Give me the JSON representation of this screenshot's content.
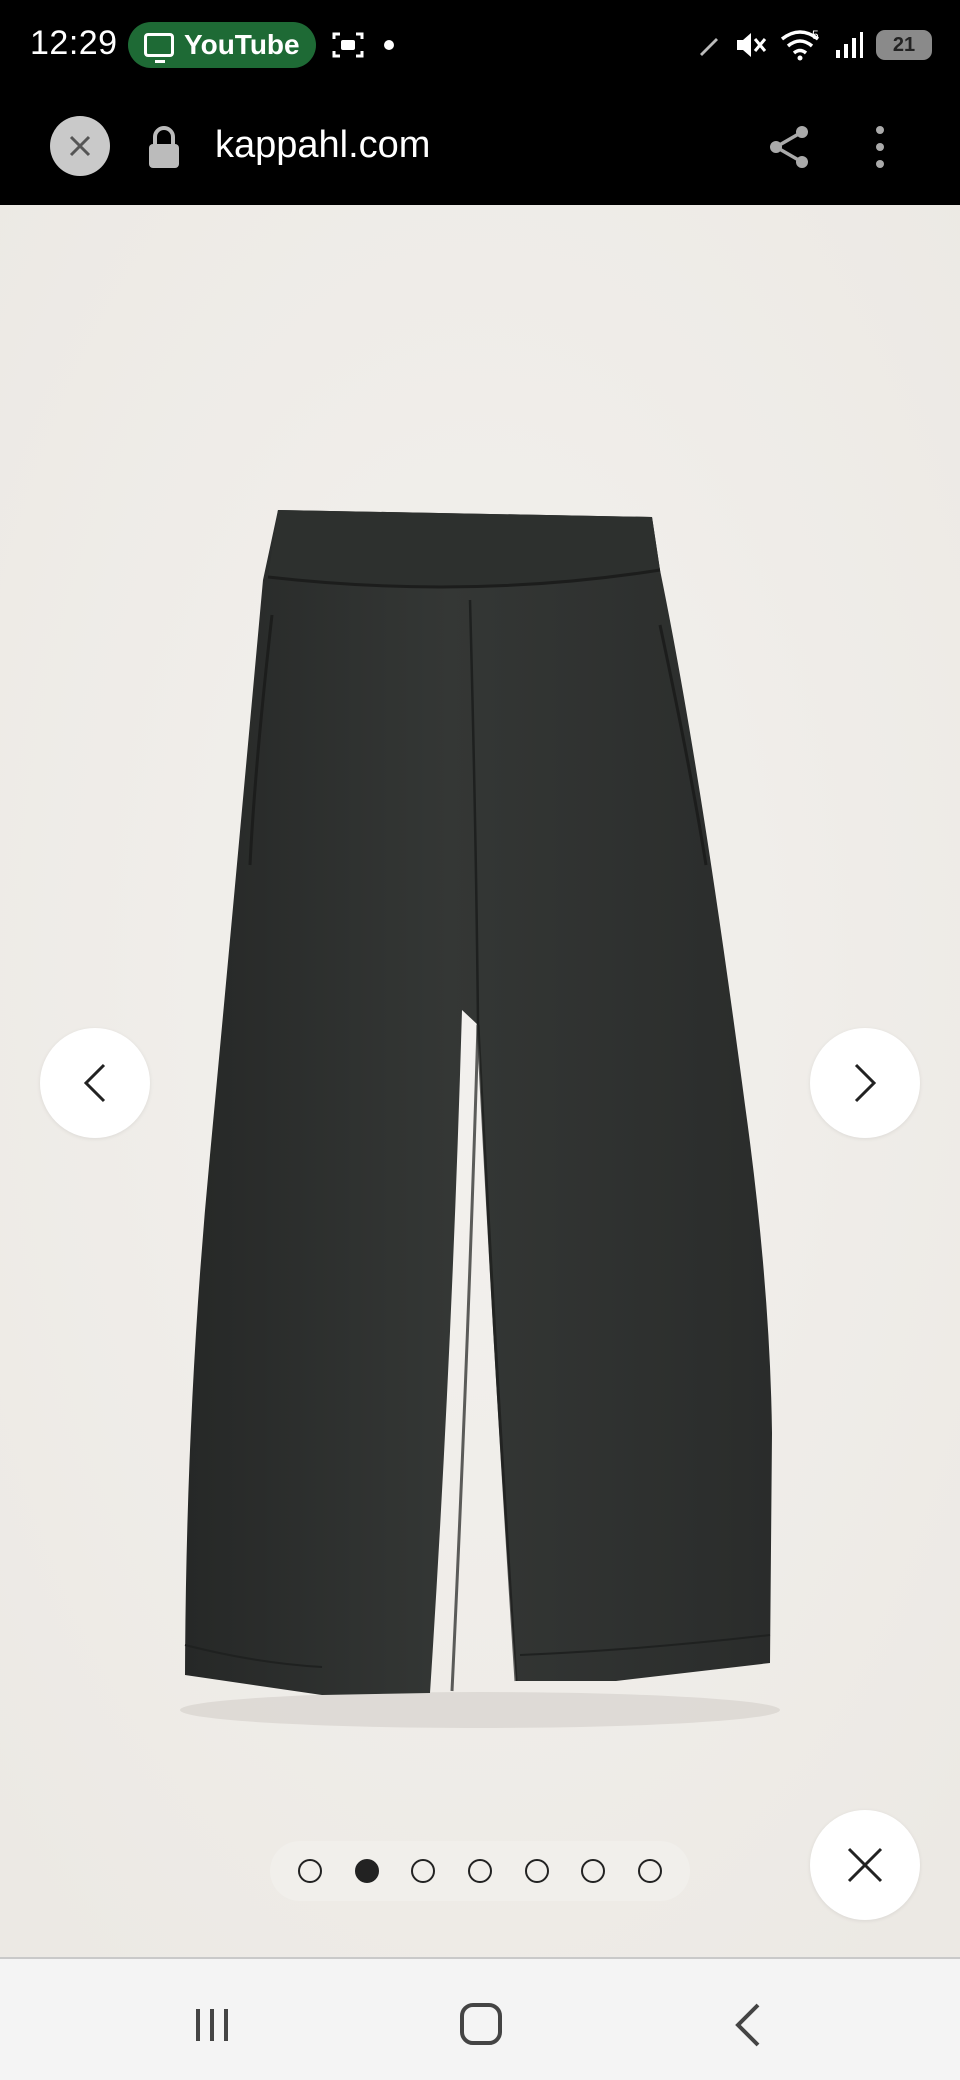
{
  "status_bar": {
    "time": "12:29",
    "app_pill_label": "YouTube",
    "battery_level": "21",
    "icons": [
      "tv-icon",
      "screenshot-icon",
      "notification-dot-icon",
      "pen-icon",
      "mute-icon",
      "wifi-icon",
      "signal-icon",
      "battery-icon"
    ]
  },
  "browser": {
    "url": "kappahl.com",
    "icons": [
      "close-icon",
      "lock-icon",
      "share-icon",
      "more-vert-icon"
    ]
  },
  "gallery": {
    "image_alt": "product-image-pants",
    "page_count": 7,
    "active_index": 1,
    "colors": {
      "background": "#efede9",
      "product": "#2f3230"
    }
  },
  "system_nav": {
    "icons": [
      "recent-apps-icon",
      "home-icon",
      "back-icon"
    ]
  }
}
